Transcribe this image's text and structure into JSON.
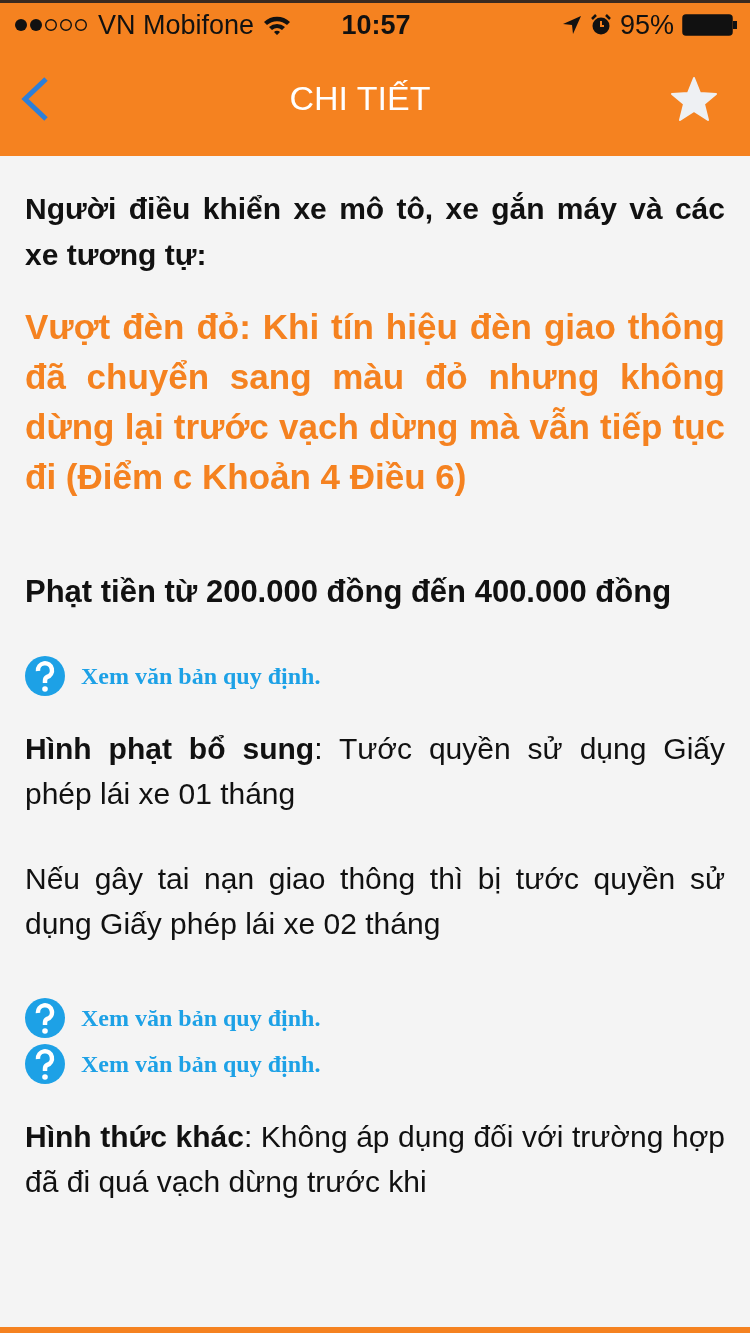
{
  "status_bar": {
    "carrier": "VN Mobifone",
    "time": "10:57",
    "battery": "95%"
  },
  "nav": {
    "title": "CHI TIẾT"
  },
  "blocks": [
    {
      "kind": "intro",
      "text": "Người điều khiển xe mô tô, xe gắn máy và các xe tương tự:"
    },
    {
      "kind": "violation",
      "text": "Vượt đèn đỏ: Khi tín hiệu đèn giao thông đã chuyển sang màu đỏ nhưng không dừng lại trước vạch dừng mà vẫn tiếp tục đi (Điểm c Khoản 4 Điều 6)"
    },
    {
      "kind": "fine",
      "text": "Phạt tiền từ 200.000 đồng đến 400.000 đồng"
    },
    {
      "kind": "link",
      "text": "Xem văn bản quy định."
    },
    {
      "kind": "para",
      "text": "**Hình phạt bổ sung**: Tước quyền sử dụng Giấy phép lái xe 01 tháng"
    },
    {
      "kind": "para",
      "text": "Nếu gây tai nạn giao thông thì bị tước quyền sử dụng Giấy phép lái xe 02 tháng"
    },
    {
      "kind": "link",
      "text": "Xem văn bản quy định."
    },
    {
      "kind": "link",
      "text": "Xem văn bản quy định."
    },
    {
      "kind": "para",
      "text": "**Hình thức khác**: Không áp dụng đối với trường hợp đã đi quá vạch dừng trước khi"
    }
  ]
}
